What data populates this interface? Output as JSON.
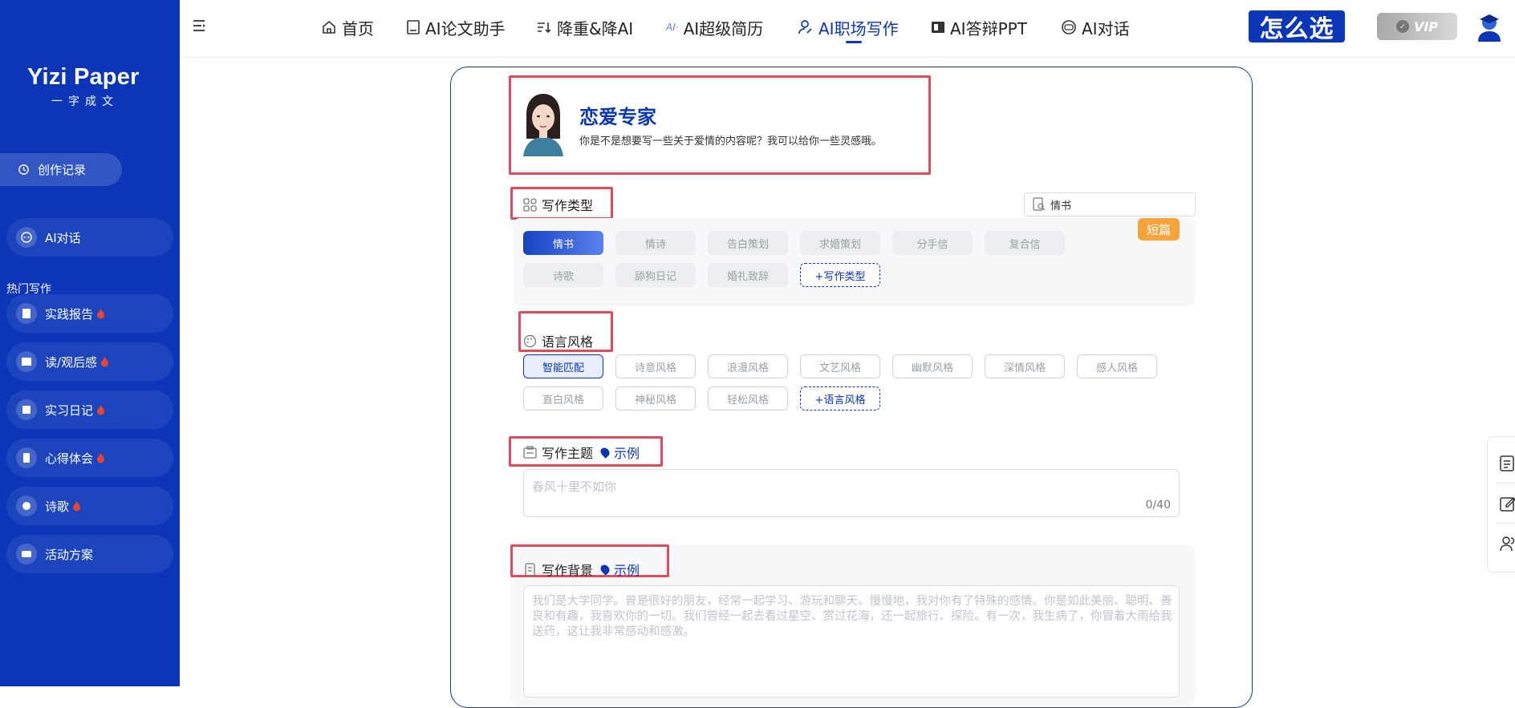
{
  "sidebar": {
    "logo": "Yizi Paper",
    "logo_sub": "一字成文",
    "history_label": "创作记录",
    "ai_chat_label": "AI对话",
    "hot_label": "热门写作",
    "items": [
      {
        "label": "实践报告",
        "icon": "report-icon",
        "hot": true
      },
      {
        "label": "读/观后感",
        "icon": "book-icon",
        "hot": true
      },
      {
        "label": "实习日记",
        "icon": "diary-icon",
        "hot": true
      },
      {
        "label": "心得体会",
        "icon": "note-icon",
        "hot": true
      },
      {
        "label": "诗歌",
        "icon": "poem-icon",
        "hot": true
      },
      {
        "label": "活动方案",
        "icon": "plan-icon",
        "hot": false
      }
    ]
  },
  "nav": {
    "items": [
      {
        "label": "首页",
        "icon": "home-icon"
      },
      {
        "label": "AI论文助手",
        "icon": "paper-icon"
      },
      {
        "label": "降重&降AI",
        "icon": "sort-icon"
      },
      {
        "label": "AI超级简历",
        "icon": "ai-icon"
      },
      {
        "label": "AI职场写作",
        "icon": "person-icon",
        "active": true
      },
      {
        "label": "AI答辩PPT",
        "icon": "ppt-icon"
      },
      {
        "label": "AI对话",
        "icon": "chat-icon"
      }
    ],
    "choose_label": "怎么选",
    "vip_label": "VIP"
  },
  "expert": {
    "name": "恋爱专家",
    "description": "你是不是想要写一些关于爱情的内容呢？我可以给你一些灵感哦。"
  },
  "writing_type": {
    "title": "写作类型",
    "search_value": "情书",
    "badge": "短篇",
    "chips": [
      "情书",
      "情诗",
      "告白策划",
      "求婚策划",
      "分手信",
      "复合信",
      "诗歌",
      "舔狗日记",
      "婚礼致辞"
    ],
    "add_label": "+写作类型"
  },
  "language_style": {
    "title": "语言风格",
    "chips": [
      "智能匹配",
      "诗意风格",
      "浪漫风格",
      "文艺风格",
      "幽默风格",
      "深情风格",
      "感人风格",
      "直白风格",
      "神秘风格",
      "轻松风格"
    ],
    "add_label": "+语言风格"
  },
  "theme": {
    "title": "写作主题",
    "example_label": "示例",
    "placeholder": "春风十里不如你",
    "count": "0/40"
  },
  "background": {
    "title": "写作背景",
    "example_label": "示例",
    "placeholder": "我们是大学同学。曾是很好的朋友，经常一起学习、游玩和聊天。慢慢地，我对你有了特殊的感情。你是如此美丽、聪明、善良和有趣，我喜欢你的一切。我们曾经一起去看过星空、赏过花海，还一起旅行、探险。有一次，我生病了，你冒着大雨给我送药，这让我非常感动和感激。"
  },
  "colors": {
    "brand": "#0b36b8",
    "highlight_box": "#e04b5f",
    "badge": "#f6a33b"
  }
}
